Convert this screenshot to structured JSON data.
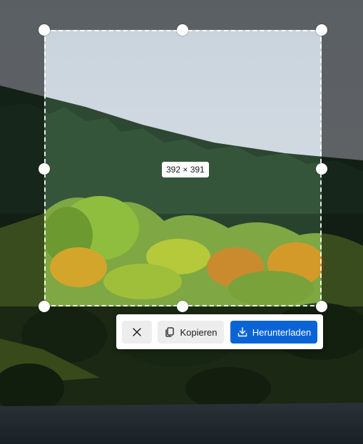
{
  "selection": {
    "size_label": "392 × 391"
  },
  "toolbar": {
    "close_icon": "close-icon",
    "copy_icon": "copy-icon",
    "copy_label": "Kopieren",
    "download_icon": "download-icon",
    "download_label": "Herunterladen",
    "accent_color": "#0a64d6"
  }
}
